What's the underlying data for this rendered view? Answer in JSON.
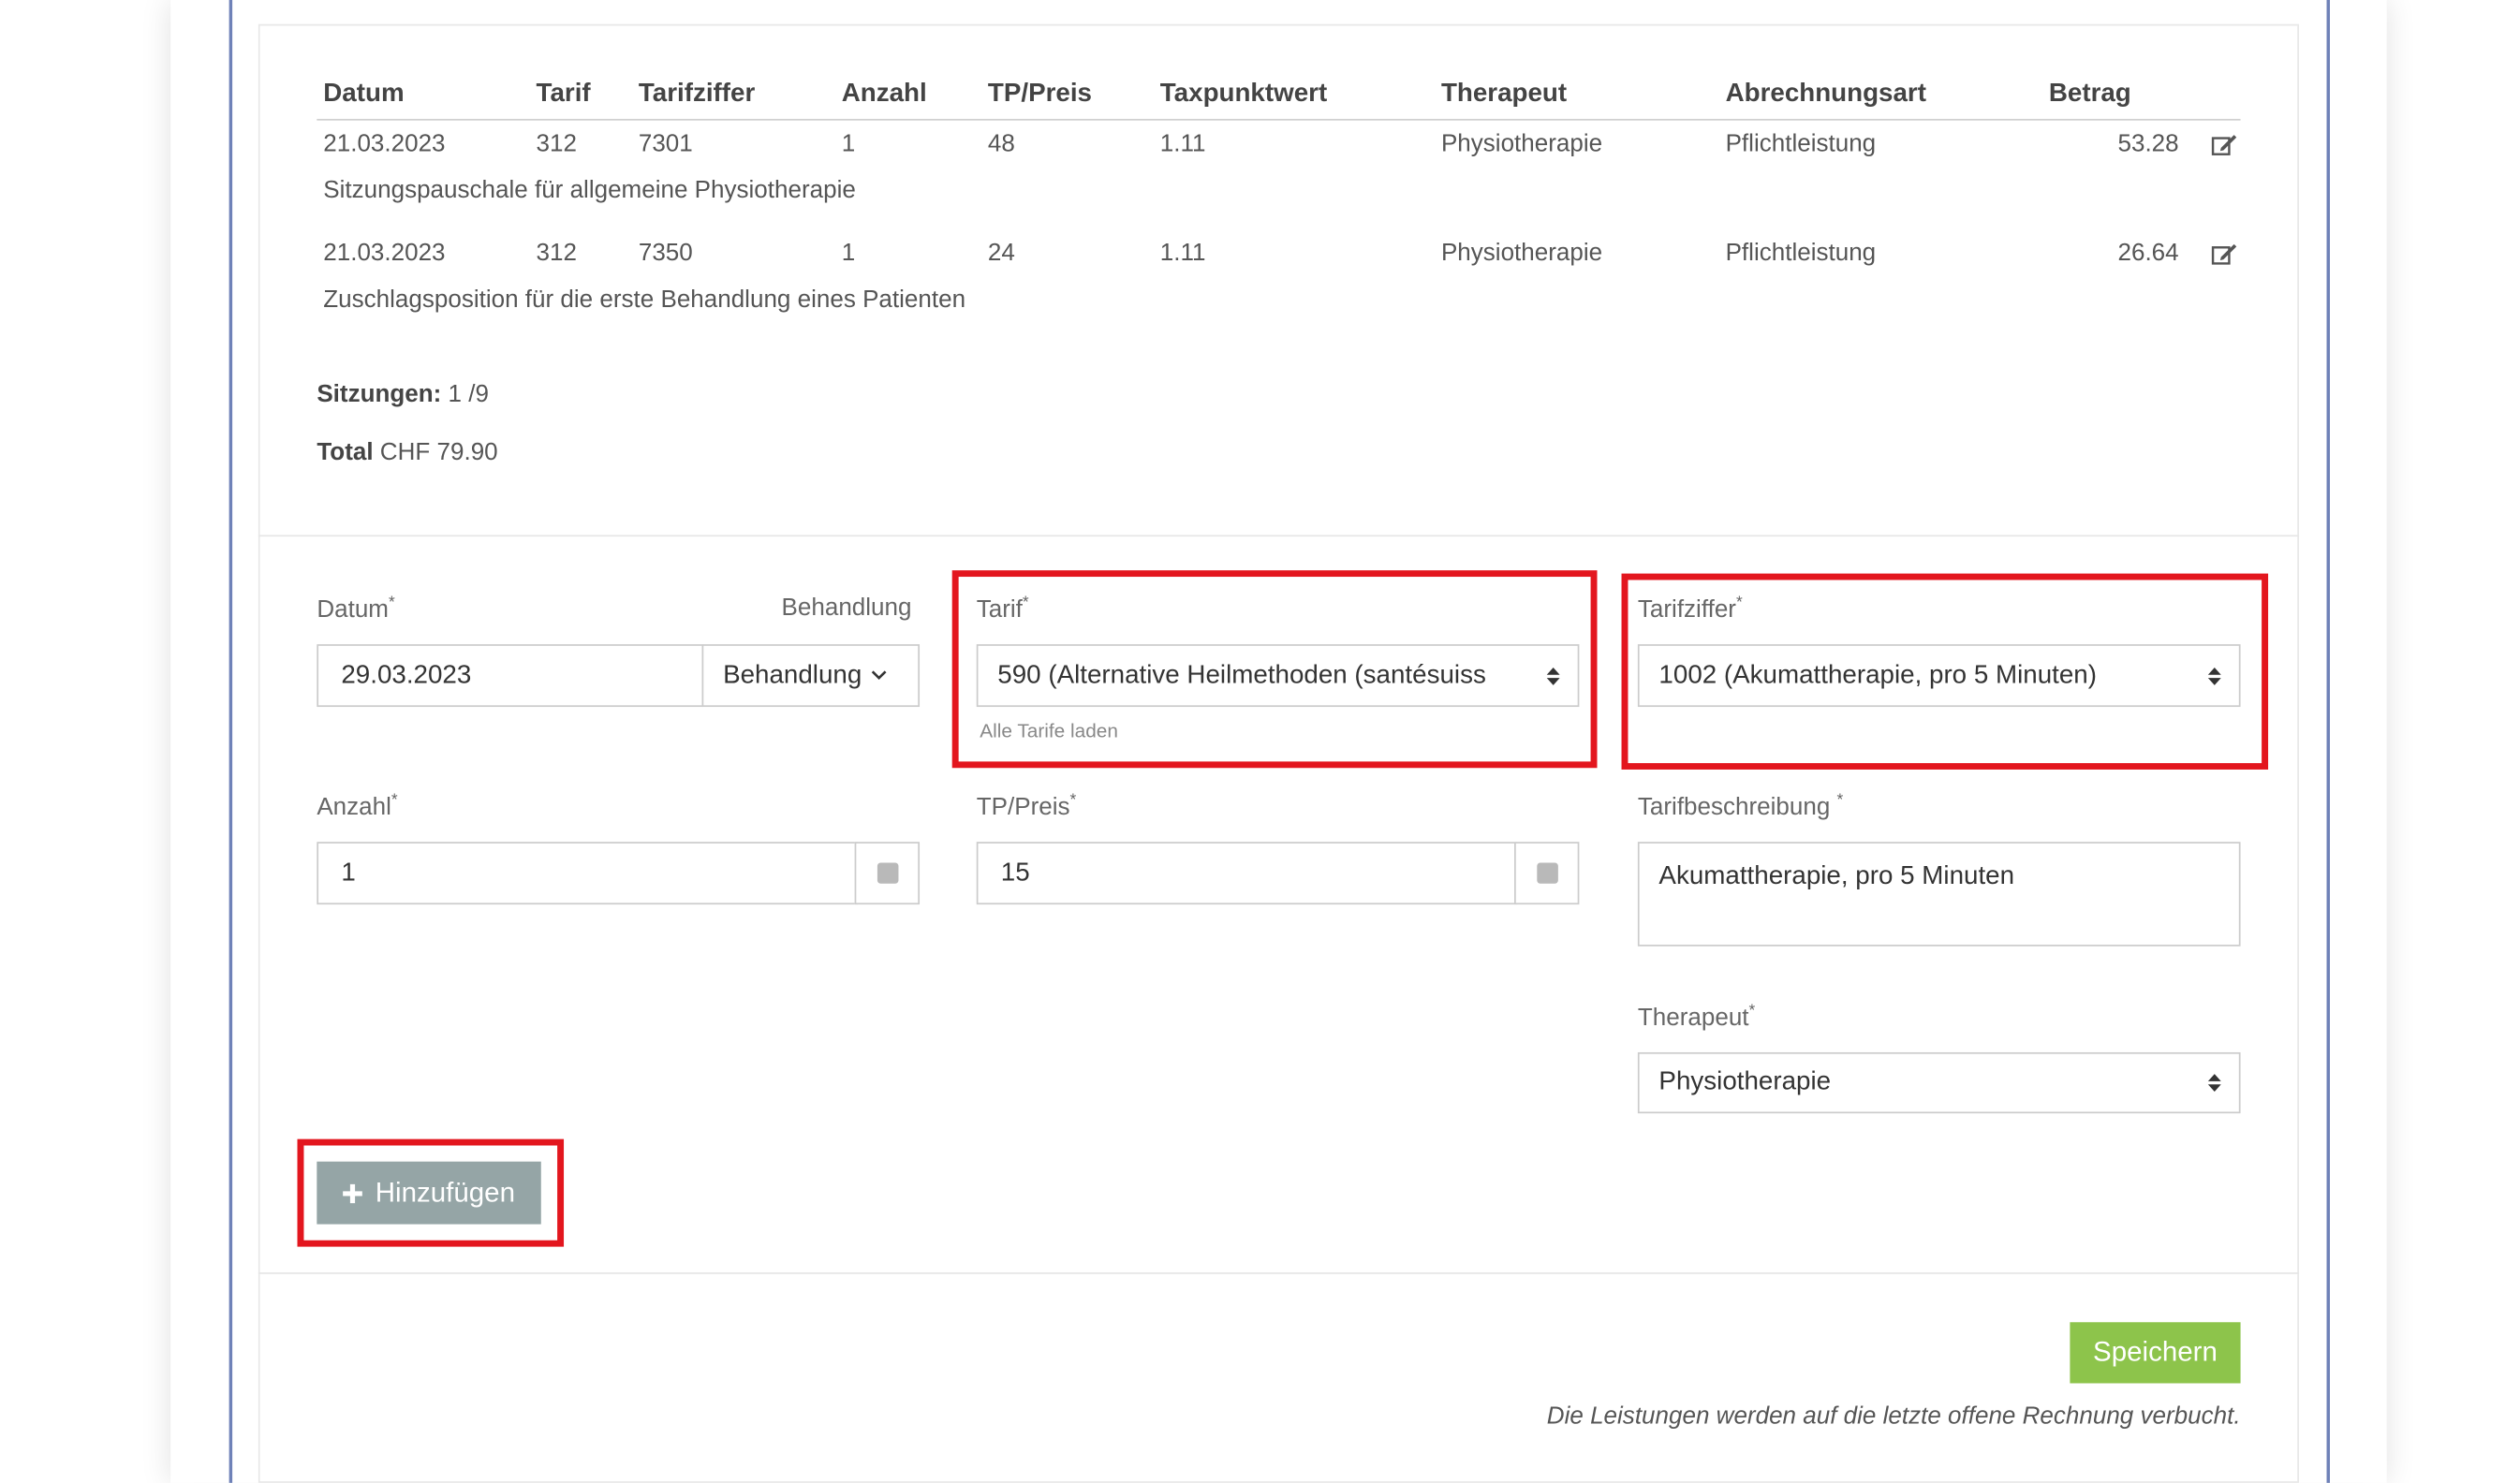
{
  "table": {
    "headers": [
      "Datum",
      "Tarif",
      "Tarifziffer",
      "Anzahl",
      "TP/Preis",
      "Taxpunktwert",
      "Therapeut",
      "Abrechnungsart",
      "Betrag"
    ],
    "rows": [
      {
        "datum": "21.03.2023",
        "tarif": "312",
        "tarifziffer": "7301",
        "anzahl": "1",
        "tp_preis": "48",
        "taxpunktwert": "1.11",
        "therapeut": "Physiotherapie",
        "abrechnungsart": "Pflichtleistung",
        "betrag": "53.28",
        "beschreibung": "Sitzungspauschale für allgemeine Physiotherapie"
      },
      {
        "datum": "21.03.2023",
        "tarif": "312",
        "tarifziffer": "7350",
        "anzahl": "1",
        "tp_preis": "24",
        "taxpunktwert": "1.11",
        "therapeut": "Physiotherapie",
        "abrechnungsart": "Pflichtleistung",
        "betrag": "26.64",
        "beschreibung": "Zuschlagsposition für die erste Behandlung eines Patienten"
      }
    ]
  },
  "summary": {
    "sitzungen_label": "Sitzungen:",
    "sitzungen_value": "1 /9",
    "total_label": "Total",
    "total_value": "CHF 79.90"
  },
  "form": {
    "datum_label": "Datum",
    "required_mark": "*",
    "behandlung_label": "Behandlung",
    "datum_value": "29.03.2023",
    "behandlung_dropdown": "Behandlung",
    "tarif_label": "Tarif",
    "tarif_value": "590 (Alternative Heilmethoden (santésuiss",
    "tarif_hint": "Alle Tarife laden",
    "tarifziffer_label": "Tarifziffer",
    "tarifziffer_value": "1002 (Akumattherapie, pro 5 Minuten)",
    "anzahl_label": "Anzahl",
    "anzahl_value": "1",
    "tp_preis_label": "TP/Preis",
    "tp_preis_value": "15",
    "tarifbeschreibung_label": "Tarifbeschreibung",
    "tarifbeschreibung_value": "Akumattherapie, pro 5 Minuten",
    "therapeut_label": "Therapeut",
    "therapeut_value": "Physiotherapie",
    "add_button": "Hinzufügen"
  },
  "footer": {
    "save_button": "Speichern",
    "note": "Die Leistungen werden auf die letzte offene Rechnung verbucht."
  },
  "colors": {
    "highlight": "#e3161e",
    "save": "#8dc44b",
    "add": "#95a5a6"
  }
}
